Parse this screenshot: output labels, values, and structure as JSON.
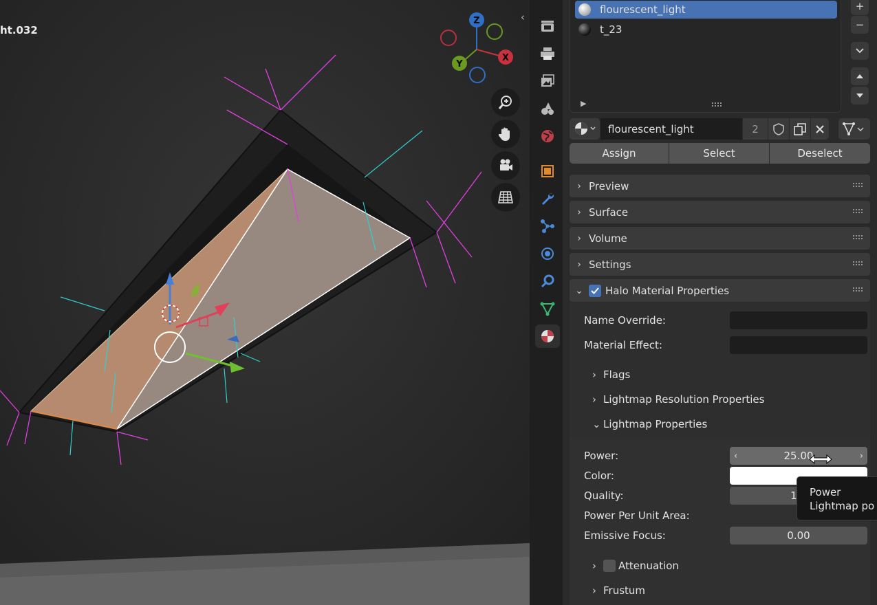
{
  "viewport": {
    "object_name": "ht.032",
    "axes": {
      "z": "Z",
      "y": "Y",
      "x": "X"
    },
    "collapse_arrow": "‹"
  },
  "material_slots": [
    {
      "name": "flourescent_light",
      "selected": true
    },
    {
      "name": "t_23",
      "selected": false
    }
  ],
  "slot_buttons": {
    "add": "+",
    "remove": "−"
  },
  "material_selector": {
    "name": "flourescent_light",
    "users": "2"
  },
  "slot_actions": {
    "assign": "Assign",
    "select": "Select",
    "deselect": "Deselect"
  },
  "sections": {
    "preview": "Preview",
    "surface": "Surface",
    "volume": "Volume",
    "settings": "Settings",
    "halo": "Halo Material Properties"
  },
  "halo": {
    "name_override_label": "Name Override:",
    "material_effect_label": "Material Effect:",
    "flags": "Flags",
    "lightmap_resolution": "Lightmap Resolution Properties",
    "lightmap_properties": "Lightmap Properties",
    "power_label": "Power:",
    "power_value": "25.00",
    "color_label": "Color:",
    "color_value": "#ffffff",
    "quality_label": "Quality:",
    "quality_value": "1.0",
    "power_per_unit_area_label": "Power Per Unit Area:",
    "emissive_focus_label": "Emissive Focus:",
    "emissive_focus_value": "0.00",
    "attenuation": "Attenuation",
    "frustum": "Frustum"
  },
  "tooltip": {
    "title": "Power",
    "body": "Lightmap po"
  },
  "colors": {
    "accent": "#4772b3",
    "panel": "#2a2a2a",
    "header": "#3a3a3a",
    "x_axis": "#e23a4c",
    "y_axis": "#6a9a22",
    "z_axis": "#2f6fc4"
  }
}
